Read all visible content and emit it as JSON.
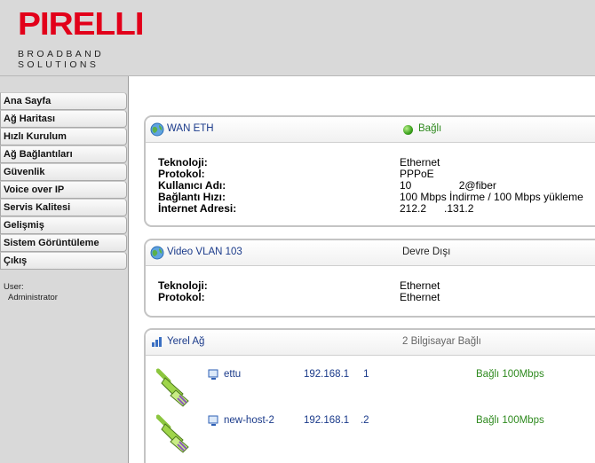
{
  "brand": {
    "logo_text": "PIRELLI",
    "sub_line1": "BROADBAND",
    "sub_line2": "SOLUTIONS"
  },
  "sidebar": {
    "items": [
      {
        "label": "Ana Sayfa"
      },
      {
        "label": "Ağ Haritası"
      },
      {
        "label": "Hızlı Kurulum"
      },
      {
        "label": "Ağ Bağlantıları"
      },
      {
        "label": "Güvenlik"
      },
      {
        "label": "Voice over IP"
      },
      {
        "label": "Servis Kalitesi"
      },
      {
        "label": "Gelişmiş"
      },
      {
        "label": "Sistem Görüntüleme"
      },
      {
        "label": "Çıkış"
      }
    ],
    "user_label": "User:",
    "user_name": "Administrator"
  },
  "wan": {
    "title": "WAN ETH",
    "status": "Bağlı",
    "rows": [
      {
        "key": "Teknoloji:",
        "value": "Ethernet"
      },
      {
        "key": "Protokol:",
        "value": "PPPoE"
      },
      {
        "key": "Kullanıcı Adı:",
        "value": "10                2@fiber"
      },
      {
        "key": "Bağlantı Hızı:",
        "value": "100 Mbps İndirme / 100 Mbps yükleme"
      },
      {
        "key": "İnternet Adresi:",
        "value": "212.2      .131.2"
      }
    ]
  },
  "vlan": {
    "title": "Video VLAN 103",
    "status": "Devre Dışı",
    "rows": [
      {
        "key": "Teknoloji:",
        "value": "Ethernet"
      },
      {
        "key": "Protokol:",
        "value": "Ethernet"
      }
    ]
  },
  "lan": {
    "title": "Yerel Ağ",
    "status": "2 Bilgisayar Bağlı",
    "hosts": [
      {
        "name": "ettu",
        "ip": "192.168.1     1",
        "status": "Bağlı 100Mbps"
      },
      {
        "name": "new-host-2",
        "ip": "192.168.1    .2",
        "status": "Bağlı 100Mbps"
      }
    ]
  },
  "colors": {
    "brand_red": "#e2001a",
    "link_blue": "#1a3a8a",
    "status_green": "#2f8a1f"
  }
}
